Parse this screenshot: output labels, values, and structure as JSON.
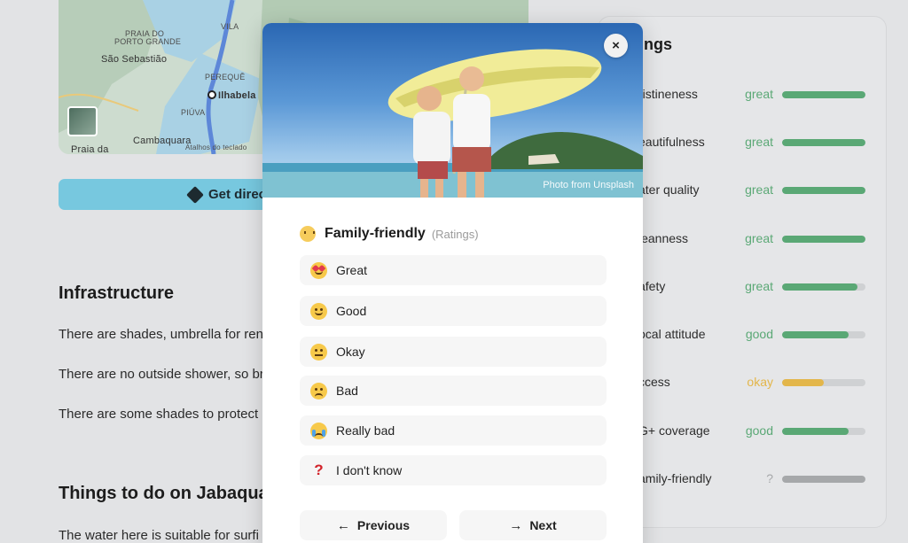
{
  "map": {
    "labels": [
      "PRAIA DO",
      "PORTO GRANDE",
      "São Sebastião",
      "VILA",
      "PEREQUÊ",
      "Ilhabela",
      "PIÚVA",
      "Cambaquara",
      "Atalhos do teclado",
      "Praia da"
    ]
  },
  "directions": {
    "label": "Get direc",
    "icon": "directions-diamond-icon"
  },
  "sections": {
    "infrastructure_title": "Infrastructure",
    "infra_lines": [
      "There are shades, umbrella for ren",
      "There are no outside shower, so br",
      "There are some shades to protect"
    ],
    "things_title": "Things to do on Jabaqua",
    "things_line": "The water here is suitable for surfi"
  },
  "ratings": {
    "title": "ngs",
    "rows": [
      {
        "name": "ristineness",
        "value": "great",
        "level": 1.0,
        "color": "#5aa875"
      },
      {
        "name": "eautifulness",
        "value": "great",
        "level": 1.0,
        "color": "#5aa875"
      },
      {
        "name": "ater quality",
        "value": "great",
        "level": 1.0,
        "color": "#5aa875"
      },
      {
        "name": "leanness",
        "value": "great",
        "level": 1.0,
        "color": "#5aa875"
      },
      {
        "name": "afety",
        "value": "great",
        "level": 0.9,
        "color": "#5aa875"
      },
      {
        "name": "ocal attitude",
        "value": "good",
        "level": 0.8,
        "color": "#5aa875"
      },
      {
        "name": "ccess",
        "value": "okay",
        "level": 0.5,
        "color": "#e3b64a"
      },
      {
        "name": "G+ coverage",
        "value": "good",
        "level": 0.8,
        "color": "#5aa875"
      },
      {
        "name": "amily-friendly",
        "value": "?",
        "level": 1.0,
        "color": "#a6a8aa"
      }
    ]
  },
  "modal": {
    "close_label": "×",
    "photo_credit": "Photo from Unsplash",
    "question": {
      "title": "Family-friendly",
      "subtitle": "(Ratings)",
      "icon": "baby-face-icon"
    },
    "options": [
      {
        "label": "Great",
        "icon": "heart-eyes-face-icon"
      },
      {
        "label": "Good",
        "icon": "smiling-face-icon"
      },
      {
        "label": "Okay",
        "icon": "neutral-face-icon"
      },
      {
        "label": "Bad",
        "icon": "frowning-face-icon"
      },
      {
        "label": "Really bad",
        "icon": "crying-face-icon"
      },
      {
        "label": "I don't know",
        "icon": "question-mark-icon"
      }
    ],
    "prev_label": "Previous",
    "next_label": "Next"
  }
}
